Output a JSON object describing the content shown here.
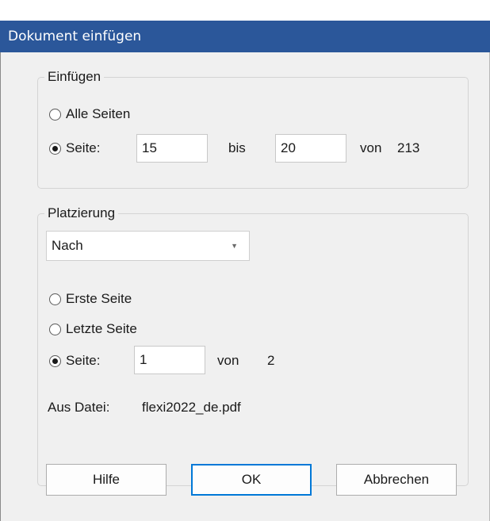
{
  "window": {
    "title": "Dokument einfügen"
  },
  "insert_group": {
    "legend": "Einfügen",
    "all_pages_label": "Alle Seiten",
    "page_label": "Seite:",
    "from_value": "15",
    "to_label": "bis",
    "to_value": "20",
    "of_label": "von",
    "total_pages": "213",
    "selected": "page_range"
  },
  "placement_group": {
    "legend": "Platzierung",
    "position_selected": "Nach",
    "first_page_label": "Erste Seite",
    "last_page_label": "Letzte Seite",
    "page_label": "Seite:",
    "page_value": "1",
    "of_label": "von",
    "total_pages": "2",
    "selected": "page",
    "source_label": "Aus Datei:",
    "source_file": "flexi2022_de.pdf"
  },
  "buttons": {
    "help": "Hilfe",
    "ok": "OK",
    "cancel": "Abbrechen"
  }
}
